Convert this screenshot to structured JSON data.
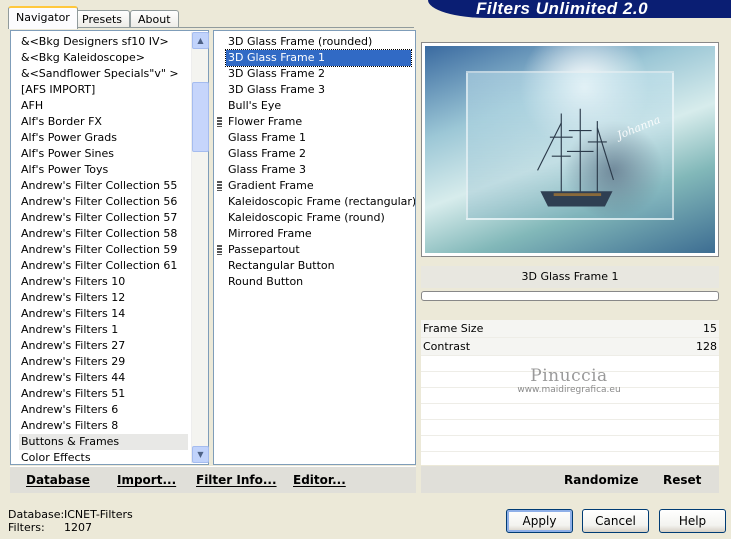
{
  "banner": {
    "title": "Filters Unlimited 2.0"
  },
  "tabs": [
    {
      "label": "Navigator",
      "active": true
    },
    {
      "label": "Presets",
      "active": false
    },
    {
      "label": "About",
      "active": false
    }
  ],
  "categories": [
    {
      "label": "&<Bkg Designers sf10 IV>"
    },
    {
      "label": "&<Bkg Kaleidoscope>"
    },
    {
      "label": "&<Sandflower Specials\"v\" >"
    },
    {
      "label": "[AFS IMPORT]"
    },
    {
      "label": "AFH"
    },
    {
      "label": "Alf's Border FX"
    },
    {
      "label": "Alf's Power Grads"
    },
    {
      "label": "Alf's Power Sines"
    },
    {
      "label": "Alf's Power Toys"
    },
    {
      "label": "Andrew's Filter Collection 55"
    },
    {
      "label": "Andrew's Filter Collection 56"
    },
    {
      "label": "Andrew's Filter Collection 57"
    },
    {
      "label": "Andrew's Filter Collection 58"
    },
    {
      "label": "Andrew's Filter Collection 59"
    },
    {
      "label": "Andrew's Filter Collection 61"
    },
    {
      "label": "Andrew's Filters 10"
    },
    {
      "label": "Andrew's Filters 12"
    },
    {
      "label": "Andrew's Filters 14"
    },
    {
      "label": "Andrew's Filters 1"
    },
    {
      "label": "Andrew's Filters 27"
    },
    {
      "label": "Andrew's Filters 29"
    },
    {
      "label": "Andrew's Filters 44"
    },
    {
      "label": "Andrew's Filters 51"
    },
    {
      "label": "Andrew's Filters 6"
    },
    {
      "label": "Andrew's Filters 8"
    },
    {
      "label": "Buttons & Frames",
      "selected": true
    },
    {
      "label": "Color Effects"
    }
  ],
  "filters": [
    {
      "label": "3D Glass Frame (rounded)"
    },
    {
      "label": "3D Glass Frame 1",
      "selected": true
    },
    {
      "label": "3D Glass Frame 2"
    },
    {
      "label": "3D Glass Frame 3"
    },
    {
      "label": "Bull's Eye"
    },
    {
      "label": "Flower Frame",
      "grip": true
    },
    {
      "label": "Glass Frame 1"
    },
    {
      "label": "Glass Frame 2"
    },
    {
      "label": "Glass Frame 3"
    },
    {
      "label": "Gradient Frame",
      "grip": true
    },
    {
      "label": "Kaleidoscopic Frame (rectangular)"
    },
    {
      "label": "Kaleidoscopic Frame (round)"
    },
    {
      "label": "Mirrored Frame"
    },
    {
      "label": "Passepartout",
      "grip": true
    },
    {
      "label": "Rectangular Button"
    },
    {
      "label": "Round Button"
    }
  ],
  "left_buttons": {
    "database": "Database",
    "import": "Import...",
    "filter_info": "Filter Info...",
    "editor": "Editor..."
  },
  "preview": {
    "signature": "Johanna"
  },
  "selected_filter_name": "3D Glass Frame 1",
  "params": [
    {
      "name": "Frame Size",
      "value": "15"
    },
    {
      "name": "Contrast",
      "value": "128"
    }
  ],
  "watermark": {
    "name": "Pinuccia",
    "url": "www.maidiregrafica.eu"
  },
  "right_buttons": {
    "randomize": "Randomize",
    "reset": "Reset"
  },
  "status": {
    "database_label": "Database:",
    "database_value": "ICNET-Filters",
    "filters_label": "Filters:",
    "filters_value": "1207"
  },
  "dialog_buttons": {
    "apply": "Apply",
    "cancel": "Cancel",
    "help": "Help"
  }
}
